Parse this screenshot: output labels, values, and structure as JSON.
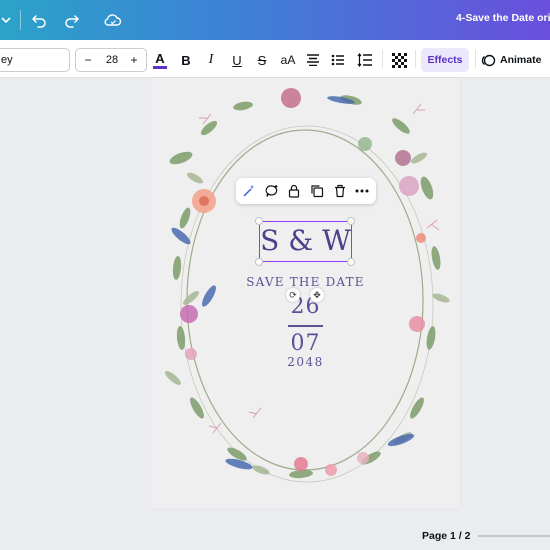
{
  "header": {
    "doc_title": "4-Save the Date ori",
    "icons": [
      "chevron-down-icon",
      "undo-icon",
      "redo-icon",
      "cloud-sync-icon"
    ]
  },
  "toolbar": {
    "font_name": "ey",
    "font_size": "28",
    "minus_label": "−",
    "plus_label": "+",
    "text_color_label": "A",
    "bold_label": "B",
    "italic_label": "I",
    "underline_label": "U",
    "strike_label": "S",
    "case_label": "aA",
    "effects_label": "Effects",
    "animate_label": "Animate",
    "text_color": "#5a32c9"
  },
  "canvas": {
    "initials": "S & W",
    "save_the_date": "SAVE THE DATE",
    "day": "26",
    "month": "07",
    "year": "2048"
  },
  "context_toolbar": {
    "icons": [
      "magic-write-icon",
      "comment-icon",
      "lock-icon",
      "duplicate-icon",
      "trash-icon",
      "more-icon"
    ]
  },
  "footer": {
    "page_indicator": "Page 1 / 2"
  },
  "colors": {
    "accent": "#8b3dff",
    "ink": "#4e3f8a",
    "header_gradient_start": "#2ba3c9",
    "header_gradient_end": "#6a4fdc"
  }
}
